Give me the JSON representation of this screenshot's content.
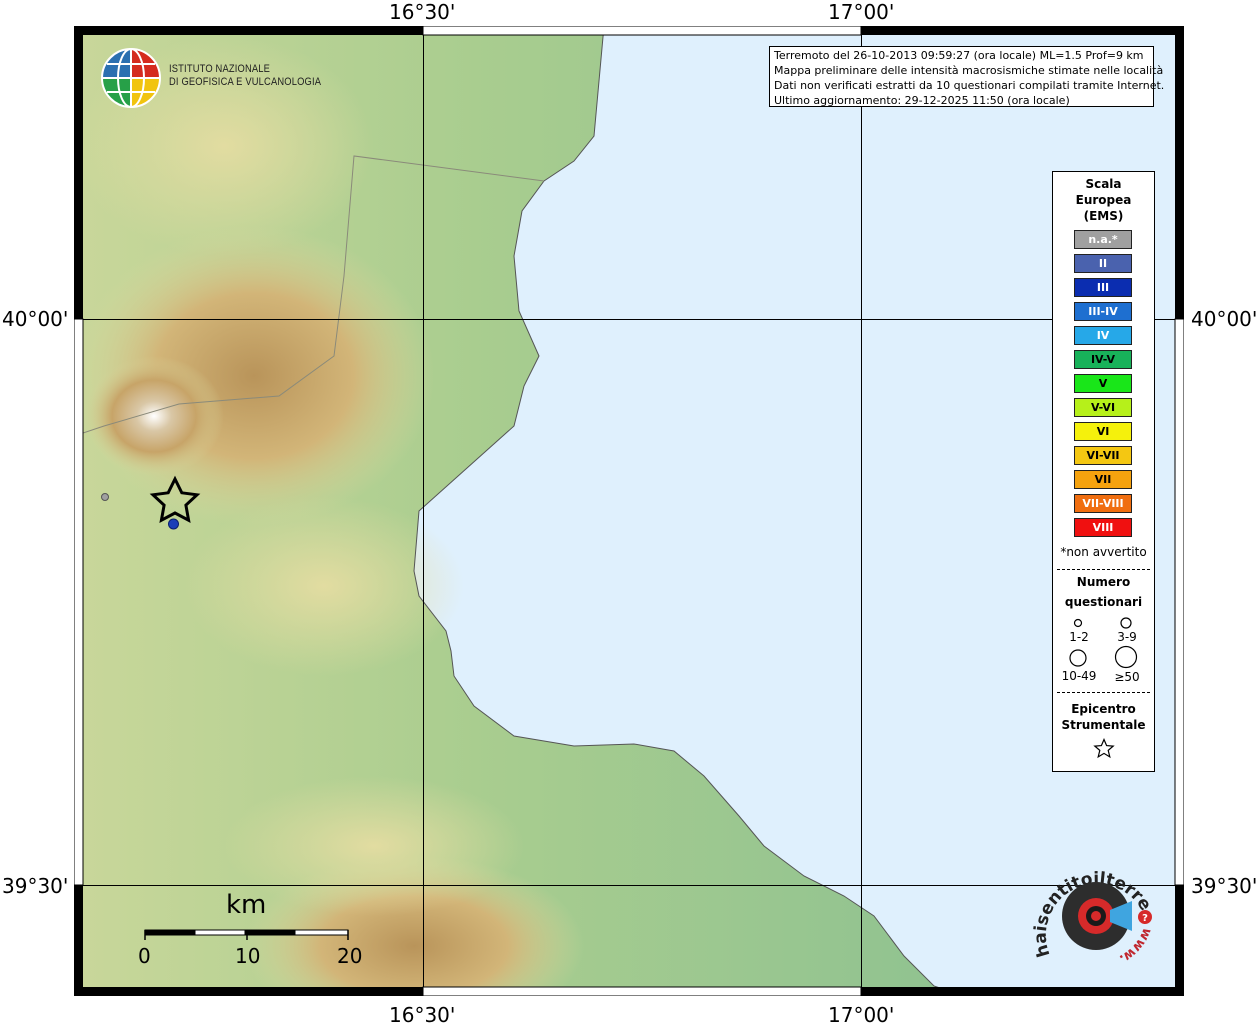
{
  "coords": {
    "top_lon_1": "16°30'",
    "top_lon_2": "17°00'",
    "bottom_lon_1": "16°30'",
    "bottom_lon_2": "17°00'",
    "left_lat_1": "40°00'",
    "left_lat_2": "39°30'",
    "right_lat_1": "40°00'",
    "right_lat_2": "39°30'"
  },
  "logo": {
    "line1": "ISTITUTO NAZIONALE",
    "line2": "DI GEOFISICA E VULCANOLOGIA"
  },
  "info": {
    "line1": "Terremoto del 26-10-2013 09:59:27 (ora locale) ML=1.5 Prof=9 km",
    "line2": "Mappa preliminare delle intensità macrosismiche stimate nelle località",
    "line3": "Dati non verificati estratti da 10 questionari compilati tramite Internet.",
    "line4": "Ultimo aggiornamento: 29-12-2025 11:50 (ora locale)"
  },
  "legend": {
    "title1": "Scala",
    "title2": "Europea",
    "title3": "(EMS)",
    "swatches": [
      {
        "label": "n.a.*",
        "color": "#a0a0a0",
        "text": "#ffffff"
      },
      {
        "label": "II",
        "color": "#4a62ae",
        "text": "#ffffff"
      },
      {
        "label": "III",
        "color": "#0b2db0",
        "text": "#ffffff"
      },
      {
        "label": "III-IV",
        "color": "#1e6fd0",
        "text": "#ffffff"
      },
      {
        "label": "IV",
        "color": "#26a8e8",
        "text": "#ffffff"
      },
      {
        "label": "IV-V",
        "color": "#18b25a",
        "text": "#000000"
      },
      {
        "label": "V",
        "color": "#19e619",
        "text": "#000000"
      },
      {
        "label": "V-VI",
        "color": "#b6f01a",
        "text": "#000000"
      },
      {
        "label": "VI",
        "color": "#f5f10c",
        "text": "#000000"
      },
      {
        "label": "VI-VII",
        "color": "#f4c712",
        "text": "#000000"
      },
      {
        "label": "VII",
        "color": "#f5a20e",
        "text": "#000000"
      },
      {
        "label": "VII-VIII",
        "color": "#f06e10",
        "text": "#ffffff"
      },
      {
        "label": "VIII",
        "color": "#f01010",
        "text": "#ffffff"
      }
    ],
    "footnote": "*non avvertito",
    "numero1": "Numero",
    "numero2": "questionari",
    "size1": "1-2",
    "size2": "3-9",
    "size3": "10-49",
    "size4": "≥50",
    "epi1": "Epicentro",
    "epi2": "Strumentale"
  },
  "scale": {
    "unit": "km",
    "ticks": [
      "0",
      "10",
      "20"
    ]
  },
  "hsit": {
    "text_top": "haisentitoilterremoto.it",
    "text_bottom": "www."
  },
  "colors": {
    "sea": "#dff0fd",
    "epicenter_marker": "#1a3fb8",
    "na_marker": "#a0a0a0"
  }
}
